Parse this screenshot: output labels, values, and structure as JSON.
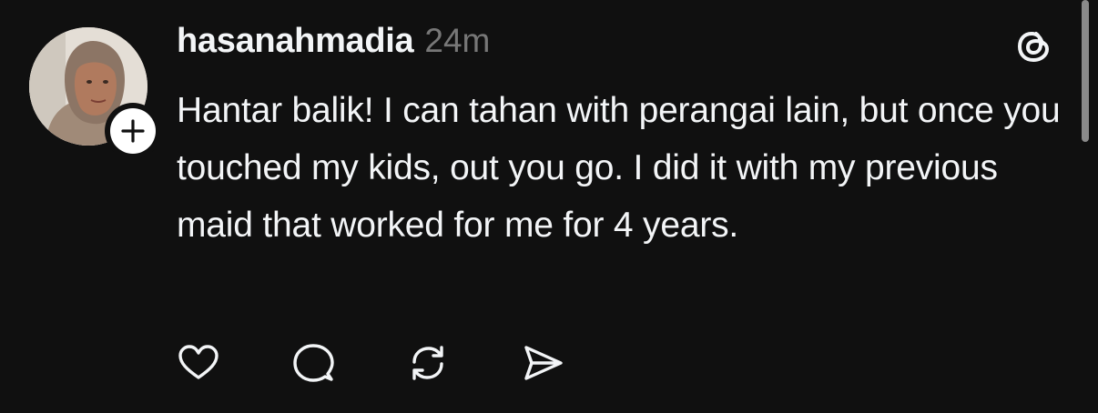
{
  "post": {
    "username": "hasanahmadia",
    "timestamp": "24m",
    "text": "Hantar balik! I can tahan with perangai lain, but once you touched my kids, out you go. I did it with my previous maid that worked for me for 4 years.",
    "app_logo_icon": "threads-logo-icon",
    "follow_icon": "plus-icon",
    "actions": [
      {
        "name": "like",
        "icon": "heart-icon"
      },
      {
        "name": "reply",
        "icon": "speech-bubble-icon"
      },
      {
        "name": "repost",
        "icon": "repost-icon"
      },
      {
        "name": "share",
        "icon": "send-icon"
      }
    ]
  },
  "colors": {
    "background": "#101010",
    "text_primary": "#f3f5f7",
    "text_secondary": "#777777"
  }
}
